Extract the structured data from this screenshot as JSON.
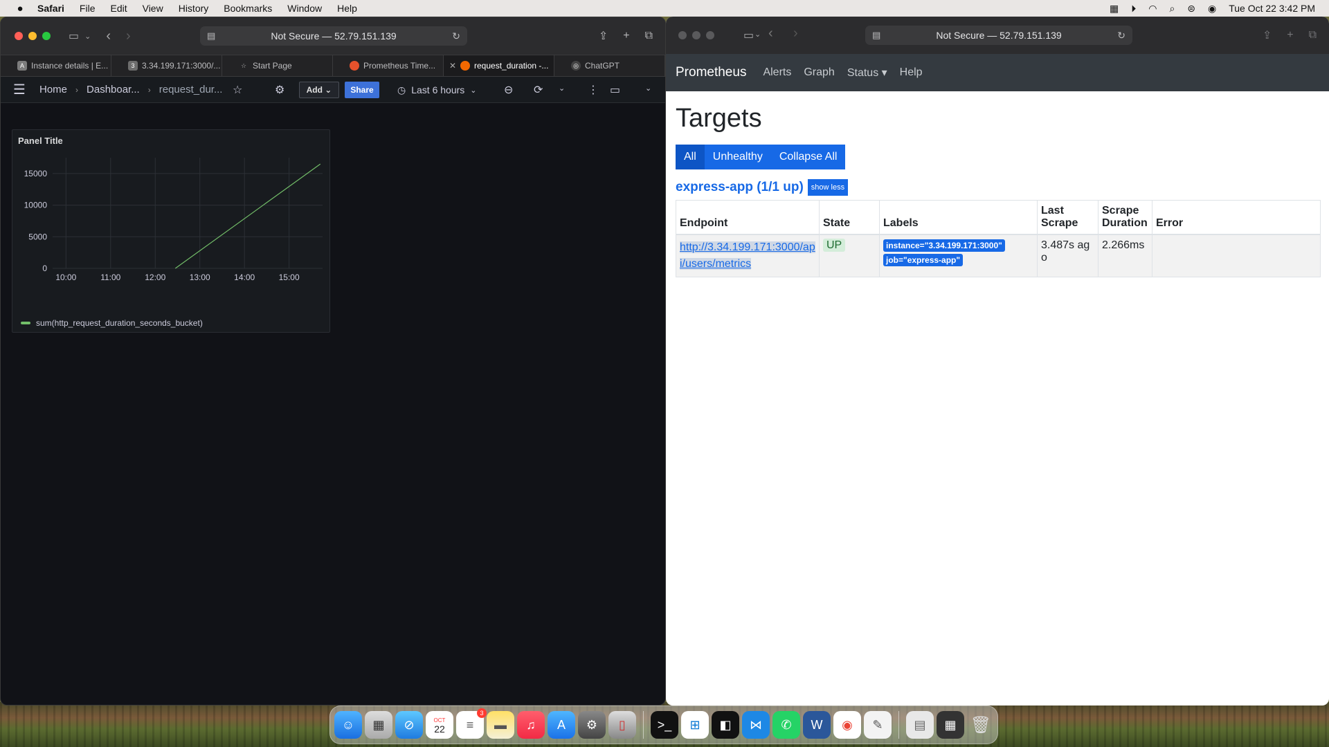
{
  "menubar": {
    "app": "Safari",
    "items": [
      "File",
      "Edit",
      "View",
      "History",
      "Bookmarks",
      "Window",
      "Help"
    ],
    "datetime": "Tue Oct 22  3:42 PM"
  },
  "left_window": {
    "url": "Not Secure — 52.79.151.139",
    "tabs": [
      {
        "label": "Instance details | E...",
        "fav_color": "#7d7d7d",
        "fav_text": "A"
      },
      {
        "label": "3.34.199.171:3000/...",
        "fav_color": "#6d6d6d",
        "fav_text": "3"
      },
      {
        "label": "Start Page",
        "fav_color": "transparent",
        "fav_text": "☆"
      },
      {
        "label": "Prometheus Time...",
        "fav_color": "#e6522c",
        "fav_text": ""
      },
      {
        "label": "request_duration -...",
        "fav_color": "#f46800",
        "fav_text": ""
      },
      {
        "label": "ChatGPT",
        "fav_color": "#444",
        "fav_text": "◎"
      }
    ],
    "grafana": {
      "breadcrumb": [
        "Home",
        "Dashboar...",
        "request_dur..."
      ],
      "add_label": "Add",
      "share_label": "Share",
      "time_range": "Last 6 hours",
      "panel_title": "Panel Title"
    }
  },
  "chart_data": {
    "type": "line",
    "title": "Panel Title",
    "xlabel": "",
    "ylabel": "",
    "x_ticks": [
      "10:00",
      "11:00",
      "12:00",
      "13:00",
      "14:00",
      "15:00"
    ],
    "y_ticks": [
      0,
      5000,
      10000,
      15000
    ],
    "ylim": [
      0,
      17500
    ],
    "xlim_hours": [
      9.7,
      15.75
    ],
    "series": [
      {
        "name": "sum(http_request_duration_seconds_bucket)",
        "color": "#73bf69",
        "x": [
          12.45,
          15.7
        ],
        "y": [
          0,
          16500
        ]
      }
    ],
    "grid": true,
    "legend": "bottom-left"
  },
  "right_window": {
    "url": "Not Secure — 52.79.151.139",
    "nav": {
      "brand": "Prometheus",
      "links": [
        "Alerts",
        "Graph",
        "Status ▾",
        "Help"
      ]
    },
    "heading": "Targets",
    "filter_buttons": [
      "All",
      "Unhealthy",
      "Collapse All"
    ],
    "job": {
      "name": "express-app (1/1 up)",
      "toggle": "show less"
    },
    "table": {
      "headers": [
        "Endpoint",
        "State",
        "Labels",
        "Last Scrape",
        "Scrape Duration",
        "Error"
      ],
      "row": {
        "endpoint": "http://3.34.199.171:3000/api/users/metrics",
        "state": "UP",
        "labels": [
          "instance=\"3.34.199.171:3000\"",
          "job=\"express-app\""
        ],
        "last_scrape": "3.487s ago",
        "duration": "2.266ms",
        "error": ""
      }
    }
  },
  "dock": {
    "reminders_badge": "3",
    "calendar_month": "OCT",
    "calendar_day": "22"
  }
}
